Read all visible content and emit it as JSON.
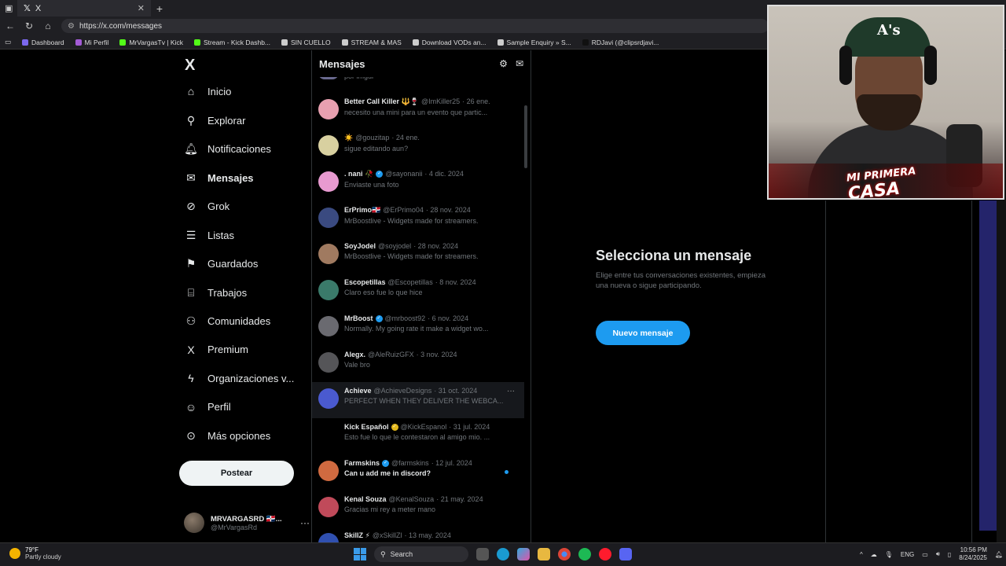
{
  "browser": {
    "tab_title": "X",
    "url": "https://x.com/messages",
    "bookmarks": [
      {
        "label": "Dashboard",
        "color": "#7b68ee"
      },
      {
        "label": "Mi Perfil",
        "color": "#a35bd6"
      },
      {
        "label": "MrVargasTv | Kick",
        "color": "#53fc18"
      },
      {
        "label": "Stream - Kick Dashb...",
        "color": "#53fc18"
      },
      {
        "label": "SIN CUELLO",
        "color": "#cccccc"
      },
      {
        "label": "STREAM & MAS",
        "color": "#cccccc"
      },
      {
        "label": "Download VODs an...",
        "color": "#cccccc"
      },
      {
        "label": "Sample Enquiry » S...",
        "color": "#cccccc"
      },
      {
        "label": "RDJavi (@clipsrdjavi...",
        "color": "#111111"
      }
    ]
  },
  "sidebar": {
    "logo": "X",
    "items": [
      {
        "label": "Inicio",
        "icon": "home-icon",
        "glyph": "⌂"
      },
      {
        "label": "Explorar",
        "icon": "search-icon",
        "glyph": "⚲"
      },
      {
        "label": "Notificaciones",
        "icon": "bell-icon",
        "glyph": "🔔︎"
      },
      {
        "label": "Mensajes",
        "icon": "mail-icon",
        "glyph": "✉"
      },
      {
        "label": "Grok",
        "icon": "grok-icon",
        "glyph": "⊘"
      },
      {
        "label": "Listas",
        "icon": "list-icon",
        "glyph": "☰"
      },
      {
        "label": "Guardados",
        "icon": "bookmark-icon",
        "glyph": "⚑"
      },
      {
        "label": "Trabajos",
        "icon": "briefcase-icon",
        "glyph": "⌸"
      },
      {
        "label": "Comunidades",
        "icon": "people-icon",
        "glyph": "⚇"
      },
      {
        "label": "Premium",
        "icon": "x-icon",
        "glyph": "X"
      },
      {
        "label": "Organizaciones v...",
        "icon": "lightning-icon",
        "glyph": "ϟ"
      },
      {
        "label": "Perfil",
        "icon": "person-icon",
        "glyph": "☺"
      },
      {
        "label": "Más opciones",
        "icon": "more-circle-icon",
        "glyph": "⊙"
      }
    ],
    "post_label": "Postear",
    "account": {
      "name": "MRVARGASRD 🇩🇴...",
      "handle": "@MrVargasRd",
      "more": "···"
    }
  },
  "messages": {
    "title": "Mensajes",
    "partial_top": "por imgur",
    "conversations": [
      {
        "name": "Better Call Killer 🔱🍷",
        "handle": "@ImKiller25",
        "date": "· 26 ene.",
        "preview": "necesito una mini para un evento que partic...",
        "verified": "",
        "color": "#e8a0b0"
      },
      {
        "name": "☀️",
        "handle": "@gouzitap",
        "date": "· 24 ene.",
        "preview": "sigue editando aun?",
        "verified": "",
        "color": "#d8d0a0"
      },
      {
        "name": ". nani 🥀",
        "handle": "@sayonanii",
        "date": "· 4 dic. 2024",
        "preview": "Enviaste una foto",
        "verified": "blue",
        "color": "#e89ad0"
      },
      {
        "name": "ErPrimo🇩🇴",
        "handle": "@ErPrimo04",
        "date": "· 28 nov. 2024",
        "preview": "MrBoostlive - Widgets made for streamers.",
        "verified": "",
        "color": "#3a4a80"
      },
      {
        "name": "SoyJodel",
        "handle": "@soyjodel",
        "date": "· 28 nov. 2024",
        "preview": "MrBoostlive - Widgets made for streamers.",
        "verified": "",
        "color": "#a07a60"
      },
      {
        "name": "Escopetillas",
        "handle": "@Escopetillas",
        "date": "· 8 nov. 2024",
        "preview": "Claro eso fue lo que hice",
        "verified": "",
        "color": "#3a7a6a"
      },
      {
        "name": "MrBoost",
        "handle": "@mrboost92",
        "date": "· 6 nov. 2024",
        "preview": "Normally. My going rate it make a widget wo...",
        "verified": "blue",
        "color": "#6a6a70"
      },
      {
        "name": "Alegx.",
        "handle": "@AleRuizGFX",
        "date": "· 3 nov. 2024",
        "preview": "Vale bro",
        "verified": "",
        "color": "#555558"
      },
      {
        "name": "Achieve",
        "handle": "@AchieveDesigns",
        "date": "· 31 oct. 2024",
        "preview": "PERFECT WHEN THEY DELIVER THE WEBCA...",
        "verified": "",
        "color": "#4a5ad0",
        "highlight": true
      },
      {
        "name": "Kick Español",
        "handle": "@KickEspanol",
        "date": "· 31 jul. 2024",
        "preview": "Esto fue lo que le contestaron al amigo mio. ...",
        "verified": "gold",
        "color": "#000000"
      },
      {
        "name": "Farmskins",
        "handle": "@farmskins",
        "date": "· 12 jul. 2024",
        "preview": "Can u add me in discord?",
        "verified": "blue",
        "color": "#d06a40",
        "unread": true
      },
      {
        "name": "Kenal Souza",
        "handle": "@KenalSouza",
        "date": "· 21 may. 2024",
        "preview": "Gracias mi rey a meter mano",
        "verified": "",
        "color": "#c04a5a"
      },
      {
        "name": "SkillZ ⚡",
        "handle": "@xSkillZl",
        "date": "· 13 may. 2024",
        "preview": "",
        "verified": "",
        "color": "#3050b0"
      }
    ]
  },
  "select_panel": {
    "heading": "Selecciona un mensaje",
    "body": "Elige entre tus conversaciones existentes, empieza una nueva o sigue participando.",
    "button": "Nuevo mensaje"
  },
  "webcam": {
    "brand_line1": "MI PRIMERA",
    "brand_line2": "CASA",
    "cap_logo": "A's"
  },
  "taskbar": {
    "temp": "79°F",
    "weather": "Partly cloudy",
    "search": "Search",
    "lang": "ENG",
    "time": "10:56 PM",
    "date": "8/24/2025"
  }
}
